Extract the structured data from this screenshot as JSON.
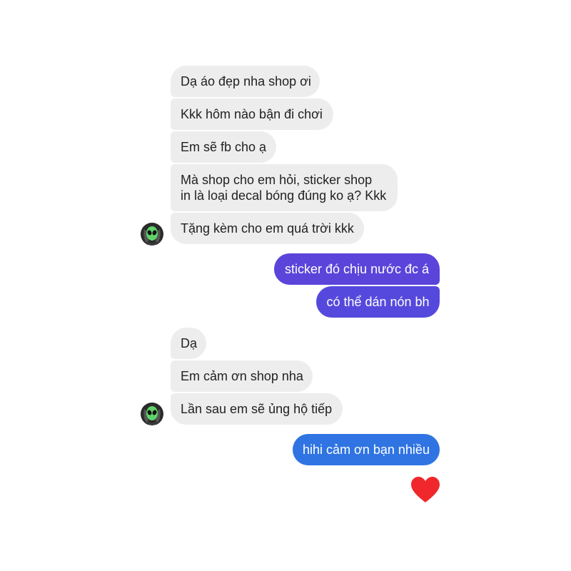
{
  "colors": {
    "incoming_bg": "#ededed",
    "outgoing_purple": "#5d42d8",
    "outgoing_blue": "#2f74e2",
    "heart": "#f0282b"
  },
  "messages": {
    "m1": "Dạ áo đẹp nha shop ơi",
    "m2": "Kkk hôm nào bận đi chơi",
    "m3": "Em sẽ fb cho ạ",
    "m4_line1": "Mà shop cho em hỏi, sticker shop",
    "m4_line2": "in là loại decal bóng đúng ko ạ? Kkk",
    "m5": "Tặng kèm cho em quá trời kkk",
    "o1": "sticker đó chịu nước đc á",
    "o2": "có thể dán nón bh",
    "m6": "Dạ",
    "m7": "Em cảm ơn shop nha",
    "m8": "Lần sau em sẽ ủng hộ tiếp",
    "o3": "hihi cảm ơn bạn nhiều"
  },
  "icons": {
    "avatar": "alien-avatar-icon",
    "reaction": "heart-icon"
  }
}
